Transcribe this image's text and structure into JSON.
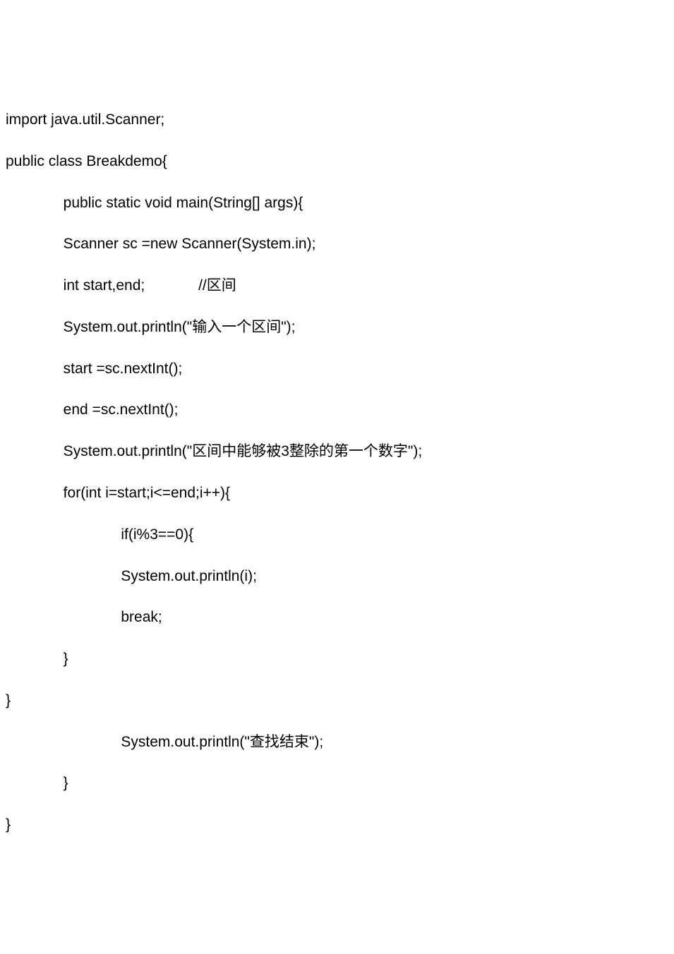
{
  "code": {
    "lines": [
      "import java.util.Scanner;",
      "public class Breakdemo{",
      "              public static void main(String[] args){",
      "              Scanner sc =new Scanner(System.in);",
      "              int start,end;             //区间",
      "              System.out.println(\"输入一个区间\");",
      "              start =sc.nextInt();",
      "              end =sc.nextInt();",
      "              System.out.println(\"区间中能够被3整除的第一个数字\");",
      "              for(int i=start;i<=end;i++){",
      "                            if(i%3==0){",
      "                            System.out.println(i);",
      "                            break;",
      "              }",
      "}",
      "                            System.out.println(\"查找结束\");",
      "              }",
      "}"
    ]
  }
}
